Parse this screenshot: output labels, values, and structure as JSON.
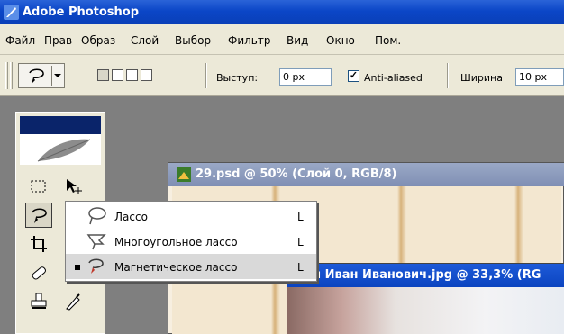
{
  "document_overlay": {
    "text": "д"
  },
  "app": {
    "title": "Adobe Photoshop"
  },
  "menu": [
    "Файл",
    "Прав",
    "Образ",
    "Слой",
    "Выбор",
    "Фильтр",
    "Вид",
    "Окно",
    "Пом."
  ],
  "options": {
    "feather_label": "Выступ:",
    "feather_value": "0 px",
    "antialiased_label": "Anti-aliased",
    "antialiased_checked": "☑",
    "width_label": "Ширина",
    "width_value": "10 px"
  },
  "documents": [
    {
      "title": "29.psd @ 50% (Слой 0, RGB/8)"
    },
    {
      "title": "й Иван Иванович.jpg @ 33,3% (RG"
    }
  ],
  "lasso_flyout": {
    "items": [
      {
        "label": "Лассо",
        "shortcut": "L",
        "selected": false,
        "icon": "lasso-icon"
      },
      {
        "label": "Многоугольное лассо",
        "shortcut": "L",
        "selected": false,
        "icon": "polygonal-lasso-icon"
      },
      {
        "label": "Магнетическое лассо",
        "shortcut": "L",
        "selected": true,
        "icon": "magnetic-lasso-icon"
      }
    ]
  },
  "colors": {
    "titlebar": "#0b46c7",
    "menu_bg": "#ece9d8",
    "workspace": "#7f7f7f",
    "toolbox_header": "#0a246a"
  }
}
